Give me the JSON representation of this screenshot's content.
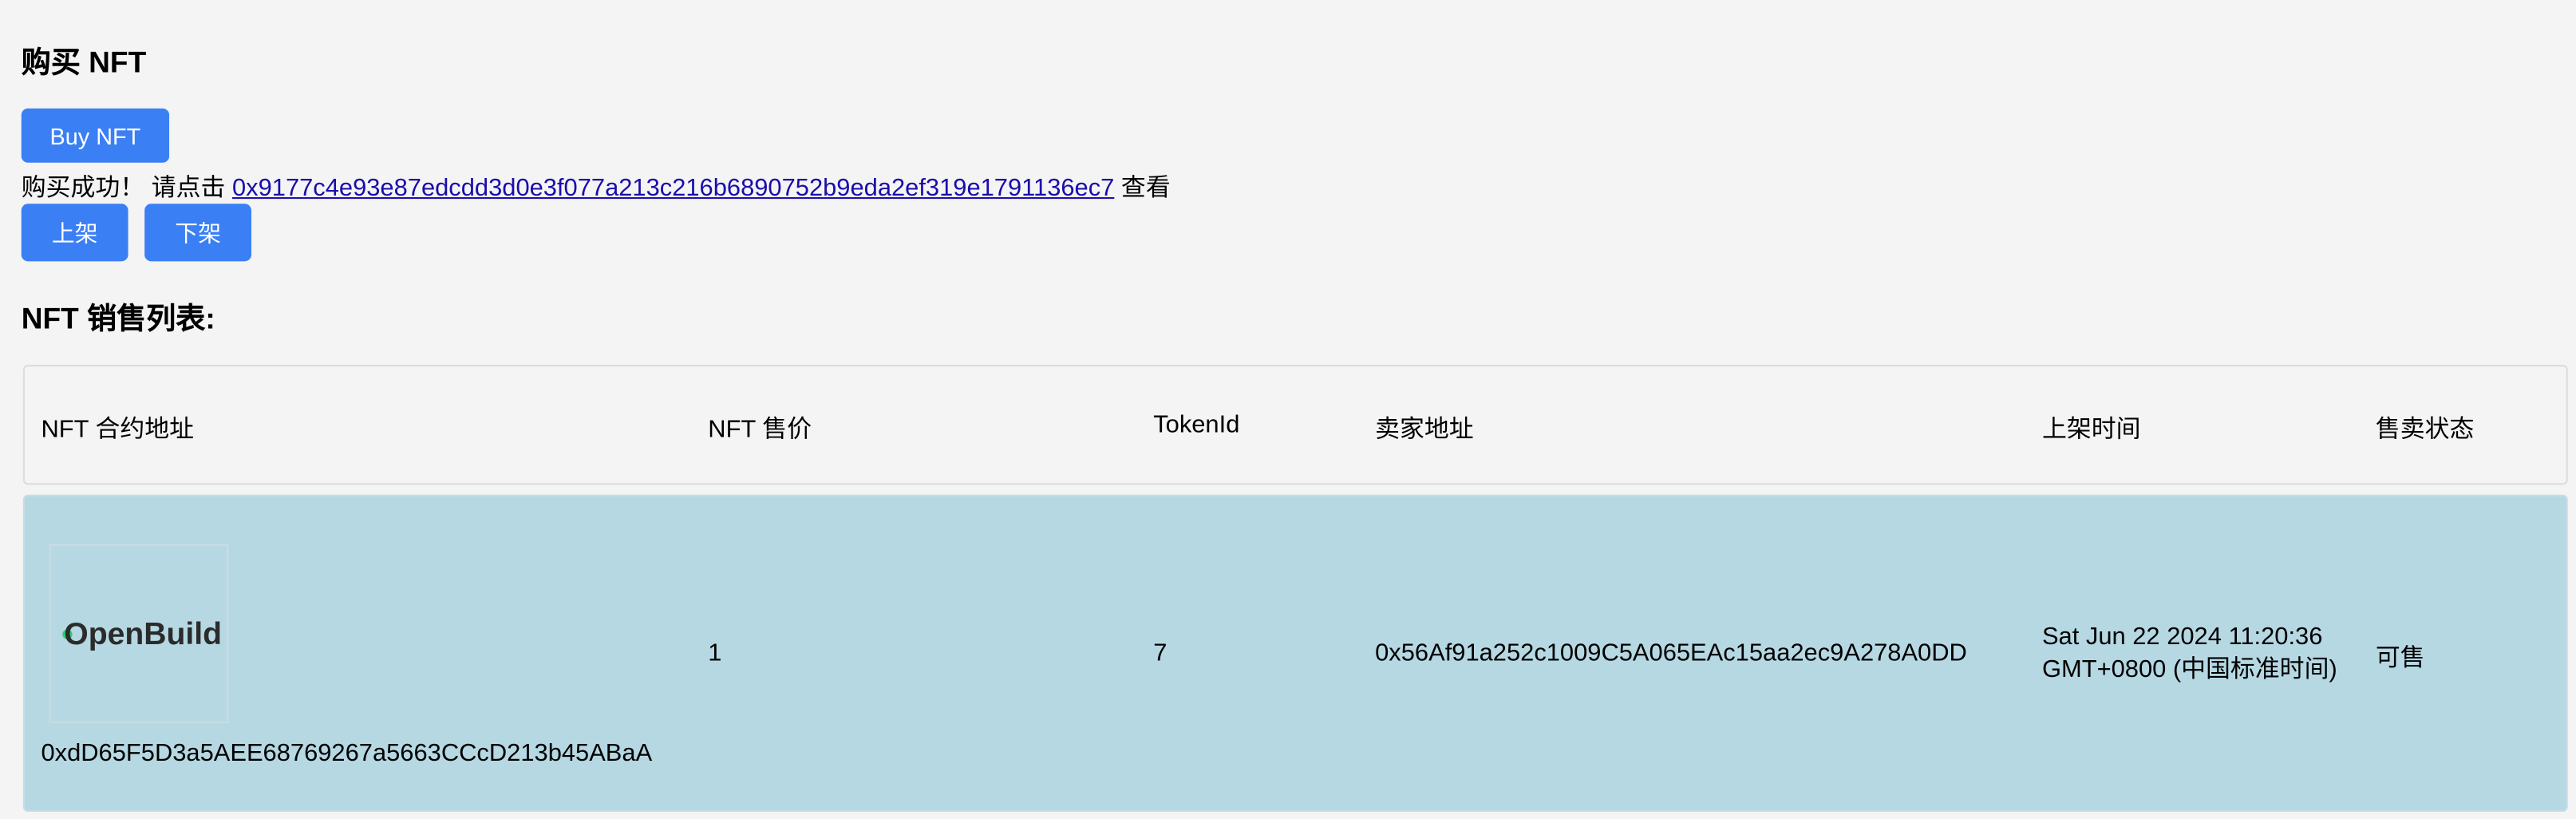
{
  "page": {
    "title": "购买 NFT",
    "buy_button": "Buy NFT",
    "message": {
      "prefix": "购买成功！ 请点击",
      "tx_hash": "0x9177c4e93e87edcdd3d0e3f077a213c216b6890752b9eda2ef319e1791136ec7",
      "suffix": "查看"
    },
    "list_button": "上架",
    "delist_button": "下架",
    "list_title": "NFT 销售列表:"
  },
  "table": {
    "headers": [
      "NFT 合约地址",
      "NFT 售价",
      "TokenId",
      "卖家地址",
      "上架时间",
      "售卖状态"
    ],
    "rows": [
      {
        "logo_text": "OpenBuild",
        "contract": "0xdD65F5D3a5AEE68769267a5663CCcD213b45ABaA",
        "price": "1",
        "token_id": "7",
        "seller": "0x56Af91a252c1009C5A065EAc15aa2ec9A278A0DD",
        "time_line1": "Sat Jun 22 2024 11:20:36",
        "time_line2": "GMT+0800 (中国标准时间)",
        "status": "可售"
      }
    ]
  },
  "colors": {
    "button": "#3b7ff5",
    "row_bg": "#b6d8e3",
    "link": "#1a0dab",
    "logo_accent": "#2ecc71"
  }
}
